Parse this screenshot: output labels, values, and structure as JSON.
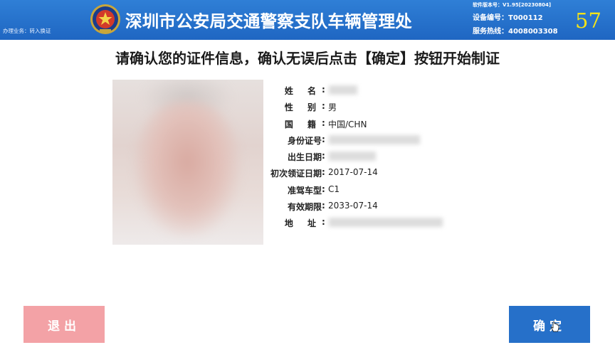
{
  "header": {
    "business": "办理业务：转入换证",
    "title": "深圳市公安局交通警察支队车辆管理处",
    "software_version": "软件版本号：V1.95[20230804]",
    "device_number": "设备编号：T000112",
    "service_hotline": "服务热线：4008003308",
    "countdown": "57"
  },
  "instruction": "请确认您的证件信息，确认无误后点击【确定】按钮开始制证",
  "fields": {
    "name_label": "姓 名",
    "gender_label": "性 别",
    "gender_value": "男",
    "nationality_label": "国 籍",
    "nationality_value": "中国/CHN",
    "id_number_label": "身份证号",
    "birth_date_label": "出生日期",
    "first_issue_label": "初次领证日期",
    "first_issue_value": "2017-07-14",
    "vehicle_class_label": "准驾车型",
    "vehicle_class_value": "C1",
    "valid_until_label": "有效期限",
    "valid_until_value": "2033-07-14",
    "address_label": "地 址"
  },
  "buttons": {
    "exit_label": "退出",
    "confirm_label": "确定"
  },
  "colors": {
    "header_blue": "#1f66c2",
    "countdown_yellow": "#f4e318",
    "exit_pink": "#f3a2a6",
    "confirm_blue": "#2670c9"
  }
}
